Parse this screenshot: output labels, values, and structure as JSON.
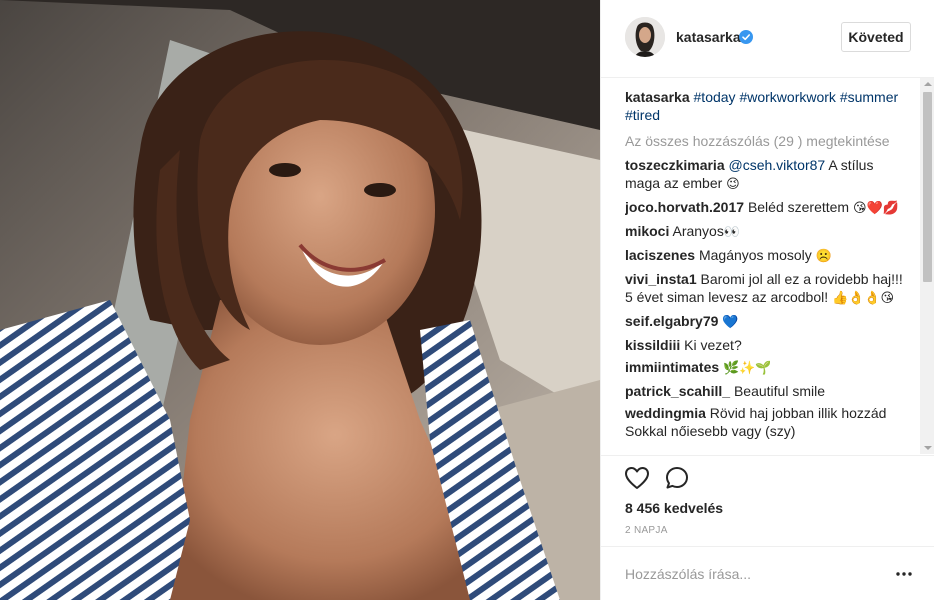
{
  "post": {
    "username": "katasarka",
    "follow_label": "Követed",
    "caption": {
      "author": "katasarka",
      "hashtags": [
        "#today",
        "#workworkwork",
        "#summer",
        "#tired"
      ]
    },
    "view_all_label": "Az összes hozzászólás (29 ) megtekintése",
    "comments": [
      {
        "user": "toszeczkimaria",
        "mention": "@cseh.viktor87",
        "text": "A stílus maga az ember",
        "emoji": "😉"
      },
      {
        "user": "joco.horvath.2017",
        "mention": "",
        "text": "Beléd szerettem",
        "emoji": "😘❤️💋"
      },
      {
        "user": "mikoci",
        "mention": "",
        "text": "Aranyos",
        "emoji": "👀"
      },
      {
        "user": "laciszenes",
        "mention": "",
        "text": "Magányos mosoly",
        "emoji": "☹️"
      },
      {
        "user": "vivi_insta1",
        "mention": "",
        "text": "Baromi jol all ez a rovidebb haj!!! 5 évet siman levesz az arcodbol!",
        "emoji": "👍👌👌😘"
      },
      {
        "user": "seif.elgabry79",
        "mention": "",
        "text": "",
        "emoji": "💙"
      },
      {
        "user": "kissildiii",
        "mention": "",
        "text": "Ki vezet?",
        "emoji": ""
      },
      {
        "user": "immiintimates",
        "mention": "",
        "text": "",
        "emoji": "🌿✨🌱"
      },
      {
        "user": "patrick_scahill_",
        "mention": "",
        "text": "Beautiful smile",
        "emoji": ""
      },
      {
        "user": "weddingmia",
        "mention": "",
        "text": "Rövid haj jobban illik hozzád Sokkal nőiesebb vagy (szy)",
        "emoji": ""
      }
    ],
    "likes_label": "8 456 kedvelés",
    "date_label": "2 NAPJA",
    "comment_placeholder": "Hozzászólás írása...",
    "icons": {
      "like": "heart-icon",
      "comment": "speech-bubble-icon",
      "more": "ellipsis-icon",
      "verified": "verified-badge-icon"
    },
    "colors": {
      "link": "#003569",
      "muted": "#999999",
      "verified": "#3897f0"
    }
  }
}
